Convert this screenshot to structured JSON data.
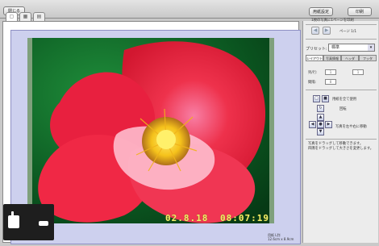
{
  "toolbar": {
    "close_label": "閉じる",
    "page_setup_label": "用紙設定",
    "print_label": "印刷"
  },
  "tabs": [
    {
      "icon": "document-icon"
    },
    {
      "icon": "grid-icon"
    },
    {
      "icon": "list-icon"
    }
  ],
  "side": {
    "page_header": "1枚の写真に1ページを印刷",
    "page_indicator": "ページ 1/1",
    "preset_label": "プリセット:",
    "preset_value": "標準",
    "panel_tabs": [
      "レイアウト",
      "写真情報",
      "ヘッダ",
      "フッタ"
    ],
    "fields": [
      {
        "label": "列/行:",
        "values": [
          "1",
          "1"
        ]
      },
      {
        "label": "間隔:",
        "values": [
          "0",
          ""
        ]
      }
    ],
    "option_1": "用紙を全て使用",
    "option_2": "回転",
    "option_3": "写真を左や右に移動",
    "help_text_1": "写真をドラッグして移動できます。",
    "help_text_2": "四隅をドラッグして大きさを変更します。"
  },
  "photo": {
    "date_stamp": "02.8.18",
    "time_stamp": "08:07:19"
  },
  "paper": {
    "name": "用紙 L判",
    "size": "12.6cm x 8.9cm"
  },
  "colors": {
    "paper_background": "#cdd0ee",
    "photo_frame": "#7fa07c",
    "date_stamp": "#f2f06a"
  }
}
